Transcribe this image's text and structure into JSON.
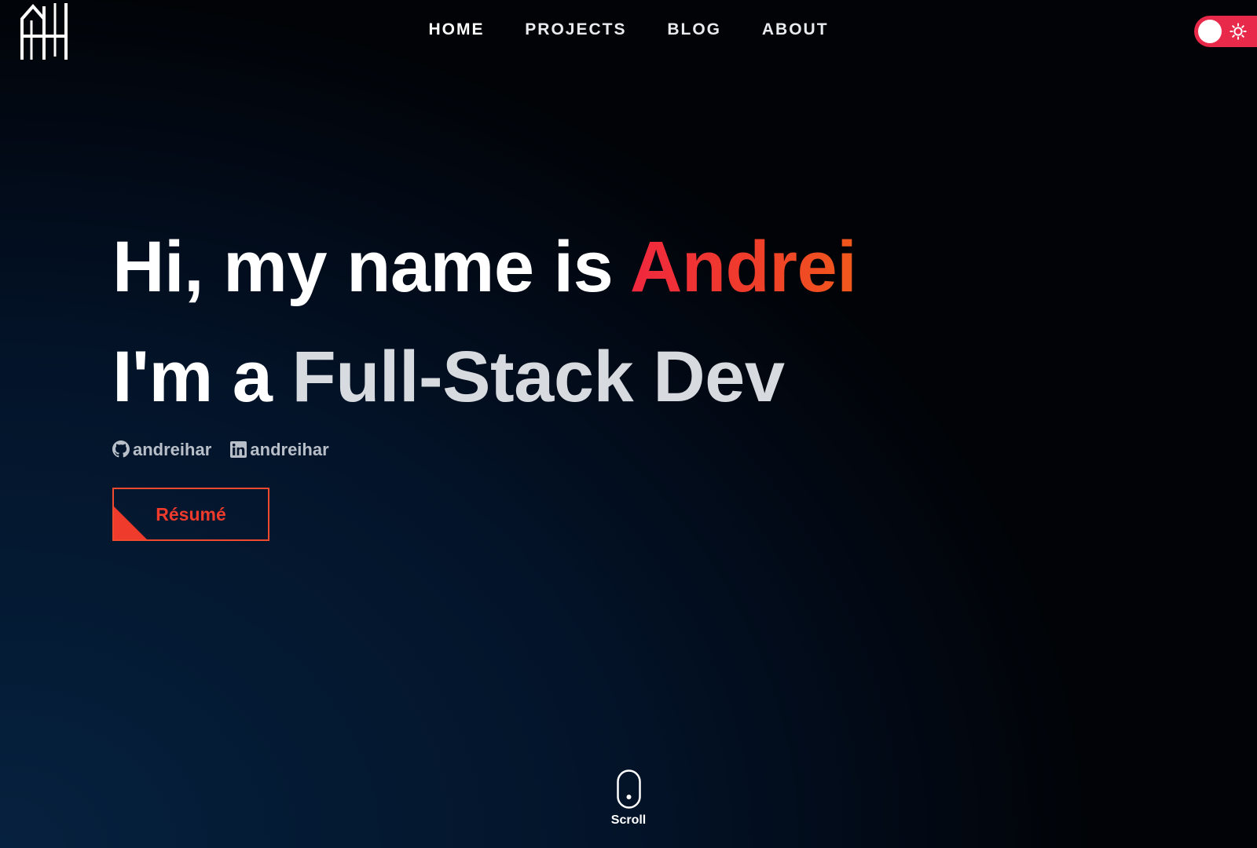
{
  "logo": {
    "text": "AH",
    "icon": "ah-monogram-logo"
  },
  "nav": {
    "items": [
      {
        "label": "HOME",
        "active": true
      },
      {
        "label": "PROJECTS",
        "active": false
      },
      {
        "label": "BLOG",
        "active": false
      },
      {
        "label": "ABOUT",
        "active": false
      }
    ]
  },
  "theme_toggle": {
    "state": "dark",
    "icon": "sun-icon",
    "color": "#e8294a"
  },
  "hero": {
    "greeting": "Hi, my name is ",
    "name": "Andrei",
    "intro": "I'm a ",
    "role": "Full-Stack Dev"
  },
  "socials": [
    {
      "icon": "github-icon",
      "handle": "andreihar"
    },
    {
      "icon": "linkedin-icon",
      "handle": "andreihar"
    }
  ],
  "resume_button": {
    "label": "Résumé",
    "accent_color": "#ef3b2c"
  },
  "scroll_indicator": {
    "label": "Scroll",
    "icon": "mouse-icon"
  },
  "colors": {
    "accent_start": "#f0283f",
    "accent_end": "#f0591c",
    "background_dark": "#010306",
    "background_navy": "#06213f"
  }
}
